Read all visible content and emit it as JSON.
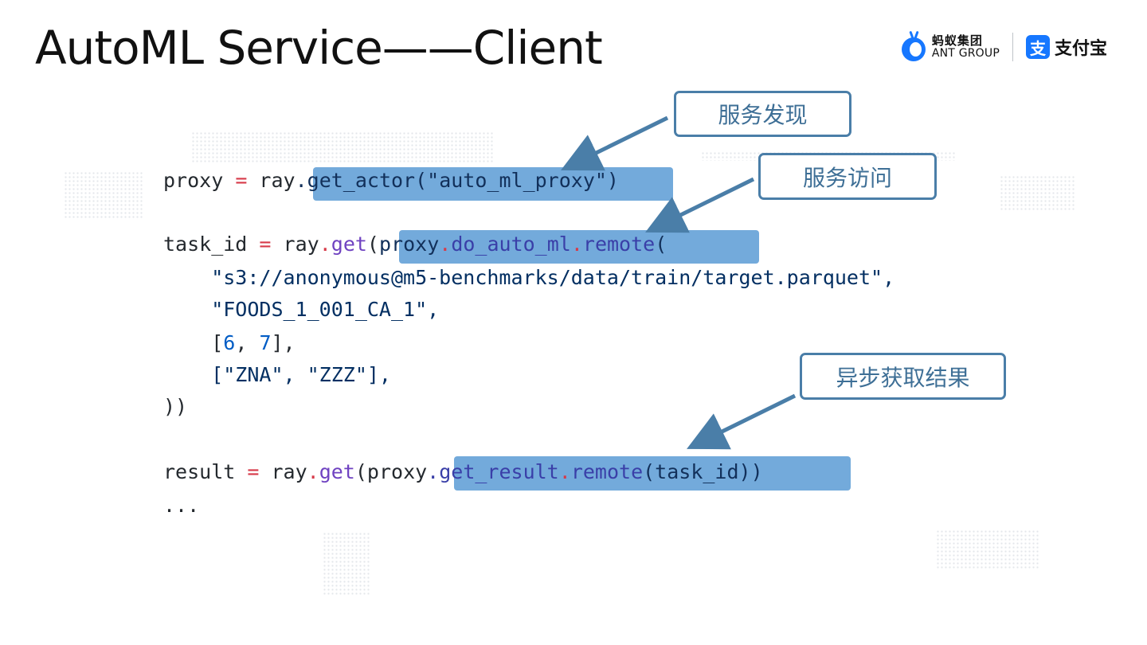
{
  "slide": {
    "title": "AutoML Service——Client"
  },
  "logos": {
    "antgroup_cn": "蚂蚁集团",
    "antgroup_en": "ANT GROUP",
    "alipay_mark": "支",
    "alipay_cn": "支付宝",
    "brand_color": "#1677ff"
  },
  "code": {
    "l1": {
      "a": "proxy ",
      "eq": "=",
      "b": " ray",
      "c": ".get_actor(\"auto_ml_proxy\")"
    },
    "l2": {
      "a": "task_id ",
      "eq": "=",
      "b": " ray",
      "dot": ".",
      "fn": "get",
      "p": "(",
      "c1": "proxy",
      "c2": ".",
      "c3": "do_auto_ml",
      "c4": ".",
      "c5": "remote",
      "c6": "("
    },
    "l3": "    \"s3://anonymous@m5-benchmarks/data/train/target.parquet\",",
    "l4": "    \"FOODS_1_001_CA_1\",",
    "l5": {
      "o": "    [",
      "n1": "6",
      "s": ", ",
      "n2": "7",
      "e": "],"
    },
    "l6": "    [\"ZNA\", \"ZZZ\"],",
    "l7": "))",
    "l8": {
      "a": "result ",
      "eq": "=",
      "b": " ray",
      "dot": ".",
      "fn": "get",
      "p": "(proxy",
      "c1": ".get_result",
      "c2": ".",
      "c3": "remote",
      "c4": "(task_id))"
    },
    "l9": "..."
  },
  "callouts": {
    "discovery": "服务发现",
    "access": "服务访问",
    "async": "异步获取结果"
  },
  "colors": {
    "highlight": "#5b9bd5",
    "callout_border": "#4a7ea8",
    "keyword_red": "#d73a49",
    "function_purple": "#6f42c1"
  }
}
